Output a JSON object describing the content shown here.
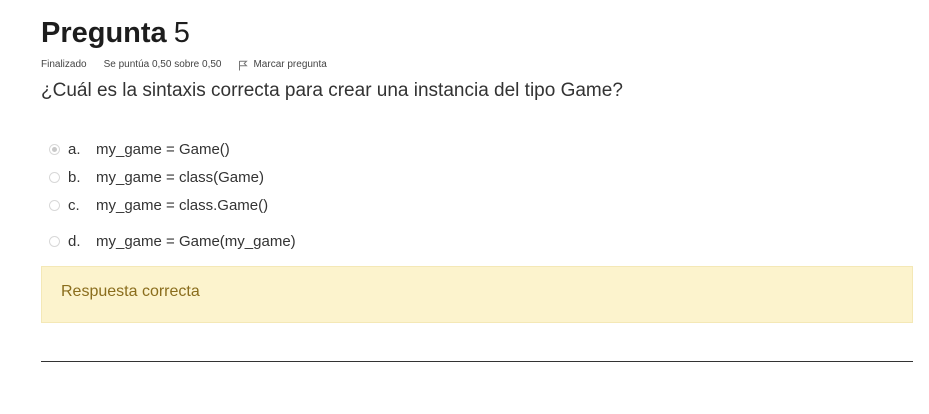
{
  "question": {
    "title_word": "Pregunta",
    "title_number": "5",
    "status": "Finalizado",
    "grade": "Se puntúa 0,50 sobre 0,50",
    "flag_label": "Marcar pregunta",
    "text": "¿Cuál es la sintaxis correcta para crear una instancia del tipo Game?"
  },
  "answers": [
    {
      "letter": "a.",
      "text": "my_game = Game()",
      "selected": true
    },
    {
      "letter": "b.",
      "text": "my_game = class(Game)",
      "selected": false
    },
    {
      "letter": "c.",
      "text": "my_game = class.Game()",
      "selected": false
    },
    {
      "letter": "d.",
      "text": "my_game = Game(my_game)",
      "selected": false
    }
  ],
  "feedback": {
    "text": "Respuesta correcta"
  },
  "colors": {
    "feedback_bg": "#fcf3cd",
    "feedback_text": "#8a6d1d"
  },
  "icons": {
    "flag": "flag-icon",
    "radio": "radio-icon"
  }
}
